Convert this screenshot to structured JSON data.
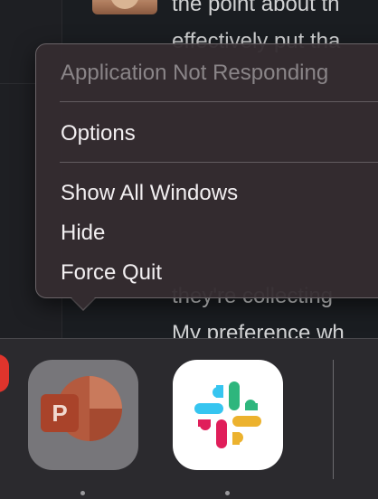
{
  "background": {
    "message_lines": [
      "the point about th",
      "effectively put tha",
      "they're collecting",
      "My preference wh"
    ]
  },
  "context_menu": {
    "header": "Application Not Responding",
    "items": [
      {
        "label": "Options"
      },
      {
        "label": "Show All Windows"
      },
      {
        "label": "Hide"
      },
      {
        "label": "Force Quit"
      }
    ]
  },
  "dock": {
    "apps": [
      {
        "name": "PowerPoint",
        "icon": "powerpoint-icon",
        "badge_letter": "P",
        "running": true
      },
      {
        "name": "Slack",
        "icon": "slack-icon",
        "running": true
      }
    ]
  },
  "colors": {
    "menu_background": "#342c30",
    "dock_background": "#2b2a2e",
    "red_indicator": "#e0342c",
    "slack_blue": "#36c5f0",
    "slack_green": "#2eb67d",
    "slack_red": "#e01e5a",
    "slack_yellow": "#ecb22e",
    "powerpoint_orange": "#b45a3e"
  }
}
